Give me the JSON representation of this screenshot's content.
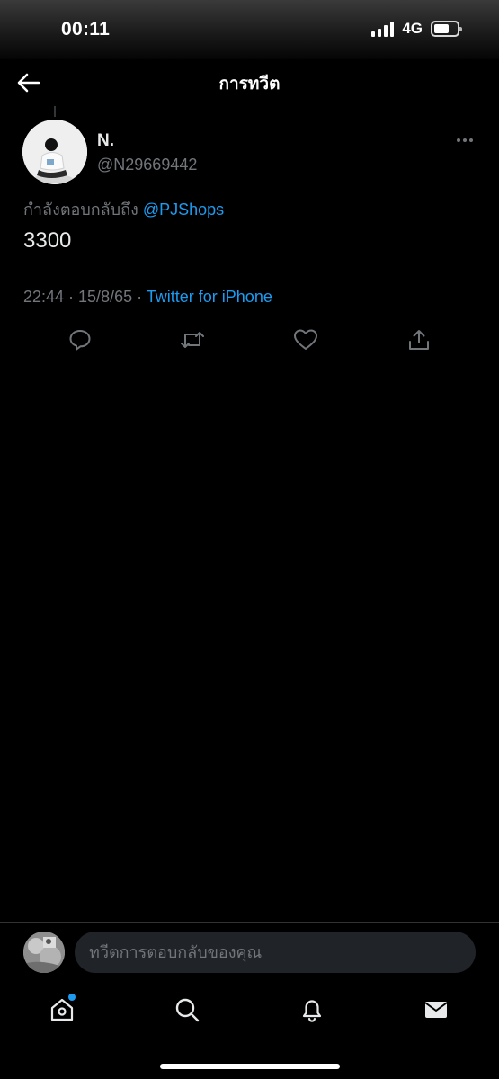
{
  "status_bar": {
    "time": "00:11",
    "network": "4G",
    "battery_level": 0.65
  },
  "header": {
    "title": "การทวีต",
    "back_icon": "arrow-left-icon"
  },
  "tweet": {
    "display_name": "N.",
    "handle": "@N29669442",
    "reply_prefix": "กำลังตอบกลับถึง",
    "reply_mention": "@PJShops",
    "text": "3300",
    "timestamp": "22:44 · 15/8/65 · ",
    "source": "Twitter for iPhone",
    "actions": [
      "reply-icon",
      "retweet-icon",
      "like-icon",
      "share-icon"
    ],
    "more_icon": "more-icon"
  },
  "reply_bar": {
    "placeholder": "ทวีตการตอบกลับของคุณ"
  },
  "bottom_nav": {
    "items": [
      "home-icon",
      "search-icon",
      "notifications-icon",
      "messages-icon"
    ],
    "home_has_notification": true
  },
  "colors": {
    "background": "#000000",
    "accent": "#1d9bf0",
    "secondary_text": "#71767b",
    "primary_text": "#e7e9ea"
  }
}
